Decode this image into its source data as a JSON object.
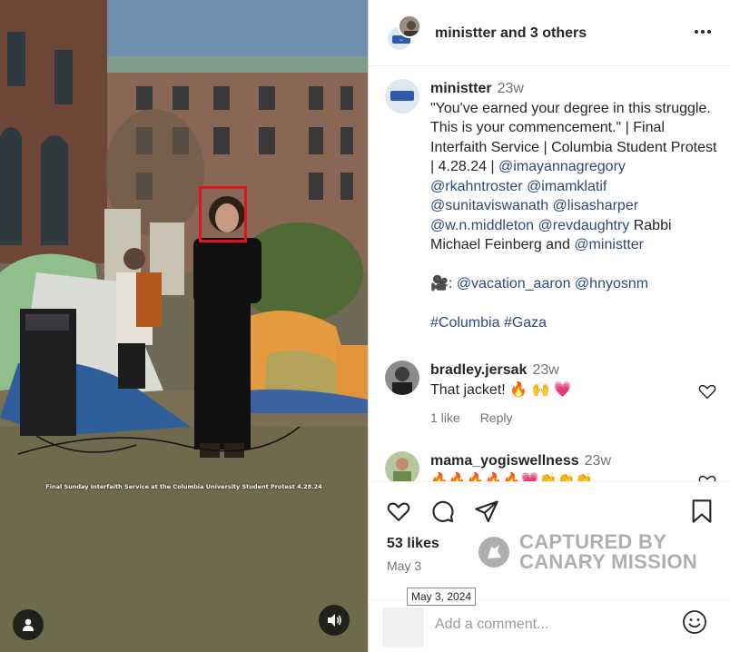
{
  "media": {
    "overlay_caption": "Final Sunday Interfaith Service at the Columbia University Student Protest 4.28.24"
  },
  "header": {
    "username": "ministter",
    "others": "and 3 others"
  },
  "caption": {
    "username": "ministter",
    "time": "23w",
    "text_1": "\"You've earned your degree in this struggle. This is your commencement.\" | Final Interfaith Service | Columbia Student Protest | 4.28.24 | ",
    "mentions_1": [
      "@imayannagregory",
      "@rkahntroster",
      "@imamklatif",
      "@sunitaviswanath",
      "@lisasharper",
      "@w.n.middleton",
      "@revdaughtry"
    ],
    "text_2": " Rabbi Michael Feinberg and ",
    "mention_last": "@ministter",
    "camera_emoji": "🎥",
    "credits_sep": ": ",
    "credits": [
      "@vacation_aaron",
      "@hnyosnm"
    ],
    "hashtags": [
      "#Columbia",
      "#Gaza"
    ]
  },
  "comments": [
    {
      "username": "bradley.jersak",
      "time": "23w",
      "text": "That jacket! 🔥 🙌 💗",
      "likes": "1 like",
      "reply": "Reply"
    },
    {
      "username": "mama_yogiswellness",
      "time": "23w",
      "text": "🔥🔥🔥🔥🔥💗👏👏👏"
    }
  ],
  "actions": {
    "likes": "53 likes",
    "date": "May 3",
    "date_tooltip": "May 3, 2024"
  },
  "watermark": {
    "line1": "CAPTURED BY",
    "line2": "CANARY MISSION"
  },
  "add_comment": {
    "placeholder": "Add a comment..."
  },
  "icons": [
    "more-icon",
    "heart-icon",
    "comment-icon",
    "share-icon",
    "bookmark-icon",
    "emoji-icon",
    "user-icon",
    "sound-icon"
  ]
}
